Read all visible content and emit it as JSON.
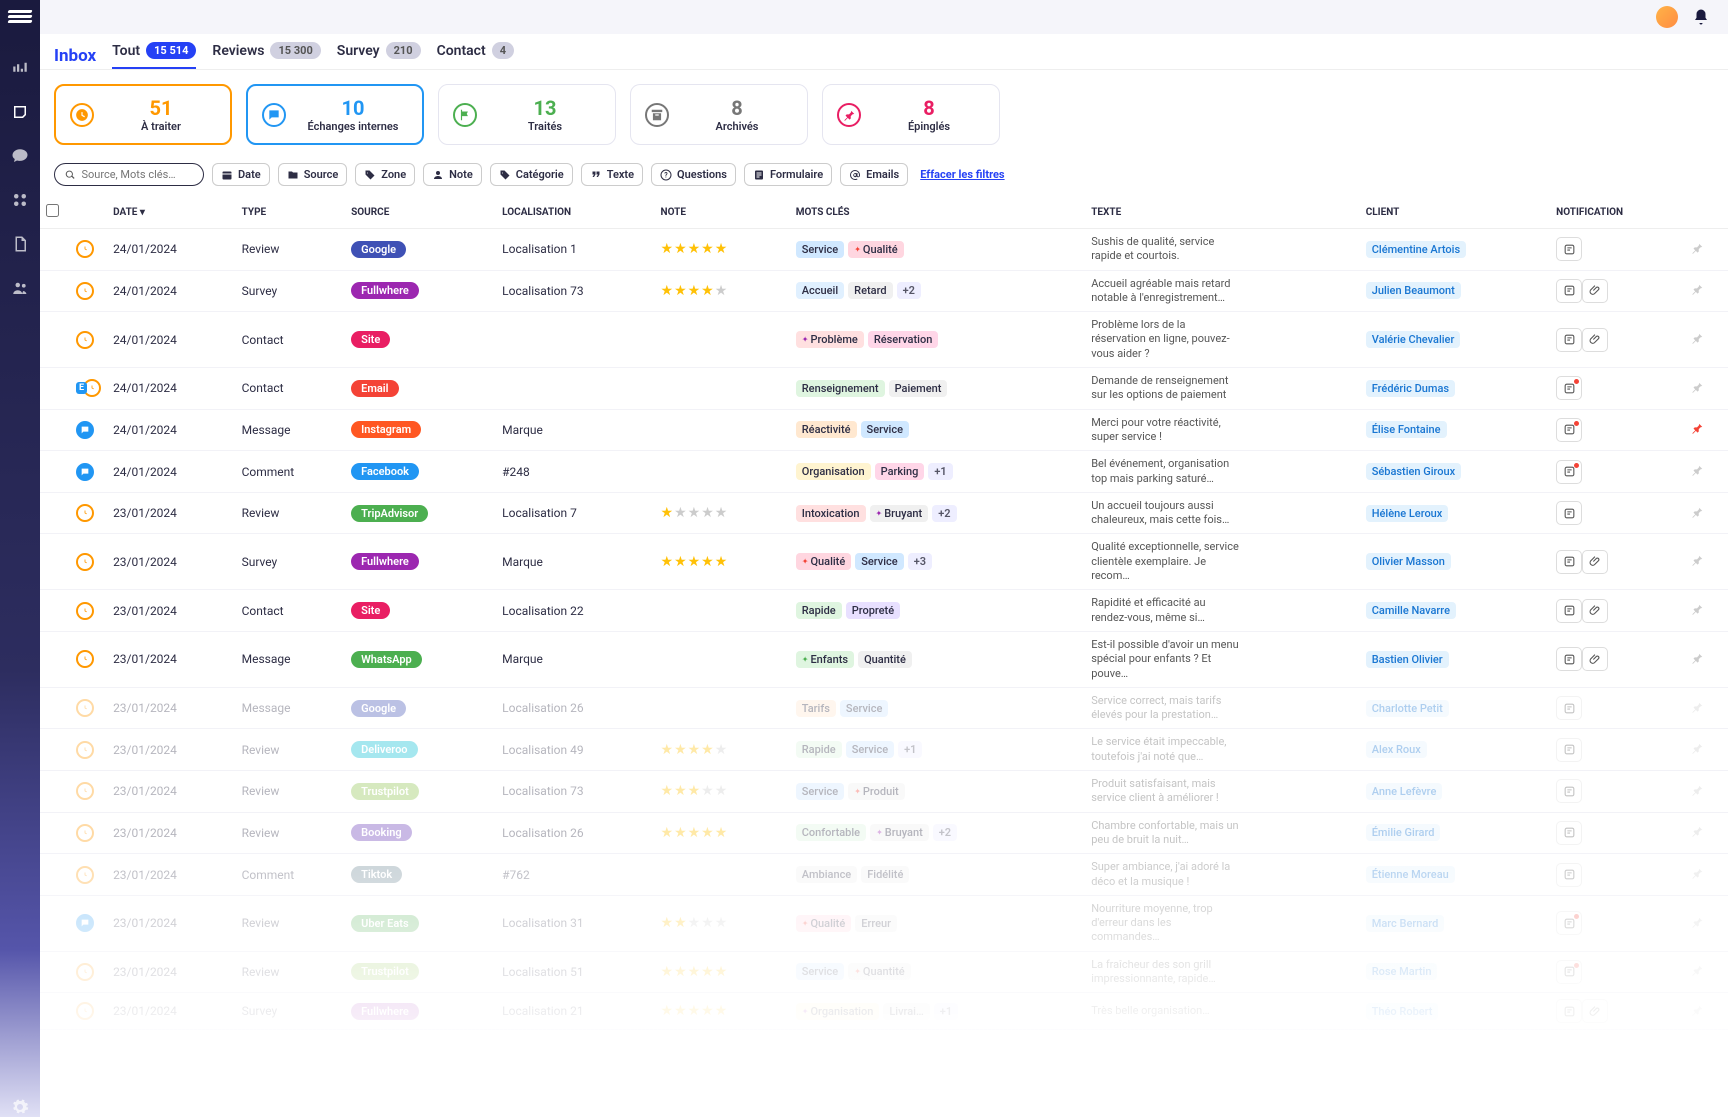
{
  "header": {
    "title": "Inbox"
  },
  "tabs": [
    {
      "label": "Tout",
      "count": "15 514",
      "active": true
    },
    {
      "label": "Reviews",
      "count": "15 300",
      "active": false
    },
    {
      "label": "Survey",
      "count": "210",
      "active": false
    },
    {
      "label": "Contact",
      "count": "4",
      "active": false
    }
  ],
  "cards": [
    {
      "num": "51",
      "label": "À traiter",
      "icon": "clock",
      "color": "#ff9800",
      "highlight": "orange"
    },
    {
      "num": "10",
      "label": "Échanges internes",
      "icon": "chat",
      "color": "#2196f3",
      "highlight": "blue"
    },
    {
      "num": "13",
      "label": "Traités",
      "icon": "flag",
      "color": "#4caf50",
      "highlight": ""
    },
    {
      "num": "8",
      "label": "Archivés",
      "icon": "archive",
      "color": "#777",
      "highlight": ""
    },
    {
      "num": "8",
      "label": "Épinglés",
      "icon": "pin",
      "color": "#e91e63",
      "highlight": ""
    }
  ],
  "search": {
    "placeholder": "Source, Mots clés…"
  },
  "filters": [
    {
      "label": "Date",
      "icon": "calendar"
    },
    {
      "label": "Source",
      "icon": "folder"
    },
    {
      "label": "Zone",
      "icon": "tag"
    },
    {
      "label": "Note",
      "icon": "user"
    },
    {
      "label": "Catégorie",
      "icon": "tag"
    },
    {
      "label": "Texte",
      "icon": "quote"
    },
    {
      "label": "Questions",
      "icon": "help"
    },
    {
      "label": "Formulaire",
      "icon": "form"
    },
    {
      "label": "Emails",
      "icon": "at"
    }
  ],
  "clear_filters": "Effacer les filtres",
  "columns": [
    "",
    "",
    "DATE ▾",
    "TYPE",
    "SOURCE",
    "LOCALISATION",
    "NOTE",
    "MOTS CLÉS",
    "TEXTE",
    "CLIENT",
    "NOTIFICATION",
    ""
  ],
  "tagColors": {
    "Service": "#d0e8ff",
    "Qualité": "#ffd6e0",
    "Accueil": "#e0f0ff",
    "Retard": "#f0f0f0",
    "Problème": "#ffe0e0",
    "Réservation": "#ffd6e8",
    "Renseignement": "#dff5e0",
    "Paiement": "#f0f0f0",
    "Réactivité": "#ffe8d0",
    "Organisation": "#fff4d0",
    "Parking": "#ffd6e8",
    "Intoxication": "#ffe0e0",
    "Bruyant": "#f0f0f0",
    "Rapide": "#dff5e0",
    "Propreté": "#e8e0ff",
    "Enfants": "#dff5e0",
    "Quantité": "#f0f0f0",
    "Tarifs": "#ffe8d0",
    "Produit": "#f0f0f0",
    "Confortable": "#dff5e0",
    "Ambiance": "#f0f0f0",
    "Fidélité": "#f0f0f0",
    "Erreur": "#f0f0f0",
    "Organisation2": "#dff5e0",
    "Livrai…": "#f0f0f0"
  },
  "sourceColors": {
    "Google": "#3f51b5",
    "Fullwhere": "#9c27b0",
    "Site": "#e91e63",
    "Email": "#f44336",
    "Instagram": "#ff5722",
    "Facebook": "#2196f3",
    "TripAdvisor": "#4caf50",
    "WhatsApp": "#4caf50",
    "Deliveroo": "#00bcd4",
    "Trustpilot": "#8bc34a",
    "Booking": "#673ab7",
    "Tiktok": "#607d8b",
    "Uber Eats": "#4caf50"
  },
  "rows": [
    {
      "statusIcon": "clock",
      "statusColor": "orange",
      "date": "24/01/2024",
      "type": "Review",
      "source": "Google",
      "loc": "Localisation 1",
      "stars": 5,
      "tags": [
        {
          "t": "Service"
        },
        {
          "t": "Qualité",
          "dot": "red"
        }
      ],
      "more": "",
      "texte": "Sushis de qualité, service rapide et courtois.",
      "client": "Clémentine Artois",
      "notif": [
        "note"
      ],
      "pinned": false,
      "faded": false
    },
    {
      "statusIcon": "clock",
      "statusColor": "orange",
      "date": "24/01/2024",
      "type": "Survey",
      "source": "Fullwhere",
      "loc": "Localisation 73",
      "stars": 4,
      "tags": [
        {
          "t": "Accueil"
        },
        {
          "t": "Retard"
        }
      ],
      "more": "+2",
      "texte": "Accueil agréable mais retard notable à l'enregistrement…",
      "client": "Julien Beaumont",
      "notif": [
        "note",
        "clip"
      ],
      "pinned": false,
      "faded": false
    },
    {
      "statusIcon": "clock",
      "statusColor": "orange",
      "date": "24/01/2024",
      "type": "Contact",
      "source": "Site",
      "loc": "",
      "stars": 0,
      "tags": [
        {
          "t": "Problème",
          "dot": "purple"
        },
        {
          "t": "Réservation"
        }
      ],
      "more": "",
      "texte": "Problème lors de la réservation en ligne, pouvez-vous aider ?",
      "client": "Valérie Chevalier",
      "notif": [
        "note",
        "clip"
      ],
      "pinned": false,
      "faded": false
    },
    {
      "statusIcon": "clock",
      "statusColor": "orange",
      "badge": "E",
      "date": "24/01/2024",
      "type": "Contact",
      "source": "Email",
      "loc": "",
      "stars": 0,
      "tags": [
        {
          "t": "Renseignement"
        },
        {
          "t": "Paiement"
        }
      ],
      "more": "",
      "texte": "Demande de renseignement sur les options de paiement",
      "client": "Frédéric Dumas",
      "notif": [
        "note-red"
      ],
      "pinned": false,
      "faded": false
    },
    {
      "statusIcon": "chat",
      "statusColor": "blue",
      "date": "24/01/2024",
      "type": "Message",
      "source": "Instagram",
      "loc": "Marque",
      "stars": 0,
      "tags": [
        {
          "t": "Réactivité"
        },
        {
          "t": "Service"
        }
      ],
      "more": "",
      "texte": "Merci pour votre réactivité, super service !",
      "client": "Élise Fontaine",
      "notif": [
        "note-red"
      ],
      "pinned": true,
      "faded": false
    },
    {
      "statusIcon": "chat",
      "statusColor": "blue",
      "date": "24/01/2024",
      "type": "Comment",
      "source": "Facebook",
      "loc": "#248",
      "stars": 0,
      "tags": [
        {
          "t": "Organisation"
        },
        {
          "t": "Parking"
        }
      ],
      "more": "+1",
      "texte": "Bel événement, organisation top mais parking saturé…",
      "client": "Sébastien Giroux",
      "notif": [
        "note-red"
      ],
      "pinned": false,
      "faded": false
    },
    {
      "statusIcon": "clock",
      "statusColor": "orange",
      "date": "23/01/2024",
      "type": "Review",
      "source": "TripAdvisor",
      "loc": "Localisation 7",
      "stars": 1,
      "tags": [
        {
          "t": "Intoxication"
        },
        {
          "t": "Bruyant",
          "dot": "purple"
        }
      ],
      "more": "+2",
      "texte": "Un accueil toujours aussi chaleureux, mais cette fois…",
      "client": "Hélène Leroux",
      "notif": [
        "note"
      ],
      "pinned": false,
      "faded": false
    },
    {
      "statusIcon": "clock",
      "statusColor": "orange",
      "date": "23/01/2024",
      "type": "Survey",
      "source": "Fullwhere",
      "loc": "Marque",
      "stars": 5,
      "tags": [
        {
          "t": "Qualité",
          "dot": "red"
        },
        {
          "t": "Service"
        }
      ],
      "more": "+3",
      "texte": "Qualité exceptionnelle, service clientèle exemplaire. Je recom…",
      "client": "Olivier Masson",
      "notif": [
        "note",
        "clip"
      ],
      "pinned": false,
      "faded": false
    },
    {
      "statusIcon": "clock",
      "statusColor": "orange",
      "date": "23/01/2024",
      "type": "Contact",
      "source": "Site",
      "loc": "Localisation 22",
      "stars": 0,
      "tags": [
        {
          "t": "Rapide"
        },
        {
          "t": "Propreté"
        }
      ],
      "more": "",
      "texte": "Rapidité et efficacité au rendez-vous, même si…",
      "client": "Camille Navarre",
      "notif": [
        "note",
        "clip"
      ],
      "pinned": false,
      "faded": false
    },
    {
      "statusIcon": "clock",
      "statusColor": "orange",
      "date": "23/01/2024",
      "type": "Message",
      "source": "WhatsApp",
      "loc": "Marque",
      "stars": 0,
      "tags": [
        {
          "t": "Enfants",
          "dot": "green"
        },
        {
          "t": "Quantité"
        }
      ],
      "more": "",
      "texte": "Est-il possible d'avoir un menu spécial pour enfants ? Et pouve…",
      "client": "Bastien Olivier",
      "notif": [
        "note",
        "clip"
      ],
      "pinned": false,
      "faded": false
    },
    {
      "statusIcon": "clock",
      "statusColor": "orange",
      "date": "23/01/2024",
      "type": "Message",
      "source": "Google",
      "loc": "Localisation 26",
      "stars": 0,
      "tags": [
        {
          "t": "Tarifs"
        },
        {
          "t": "Service"
        }
      ],
      "more": "",
      "texte": "Service correct, mais tarifs élevés pour la prestation…",
      "client": "Charlotte Petit",
      "notif": [
        "note"
      ],
      "pinned": false,
      "faded": true
    },
    {
      "statusIcon": "clock",
      "statusColor": "orange",
      "date": "23/01/2024",
      "type": "Review",
      "source": "Deliveroo",
      "loc": "Localisation 49",
      "stars": 4,
      "tags": [
        {
          "t": "Rapide"
        },
        {
          "t": "Service"
        }
      ],
      "more": "+1",
      "texte": "Le service était impeccable, toutefois j'ai noté que…",
      "client": "Alex Roux",
      "notif": [
        "note"
      ],
      "pinned": false,
      "faded": true
    },
    {
      "statusIcon": "clock",
      "statusColor": "orange",
      "date": "23/01/2024",
      "type": "Review",
      "source": "Trustpilot",
      "loc": "Localisation 73",
      "stars": 3,
      "tags": [
        {
          "t": "Service"
        },
        {
          "t": "Produit",
          "dot": "red"
        }
      ],
      "more": "",
      "texte": "Produit satisfaisant, mais service client à améliorer !",
      "client": "Anne Lefèvre",
      "notif": [
        "note"
      ],
      "pinned": false,
      "faded": true
    },
    {
      "statusIcon": "clock",
      "statusColor": "orange",
      "date": "23/01/2024",
      "type": "Review",
      "source": "Booking",
      "loc": "Localisation 26",
      "stars": 5,
      "tags": [
        {
          "t": "Confortable"
        },
        {
          "t": "Bruyant",
          "dot": "purple"
        }
      ],
      "more": "+2",
      "texte": "Chambre confortable, mais un peu de bruit la nuit…",
      "client": "Émilie Girard",
      "notif": [
        "note"
      ],
      "pinned": false,
      "faded": true
    },
    {
      "statusIcon": "clock",
      "statusColor": "orange",
      "date": "23/01/2024",
      "type": "Comment",
      "source": "Tiktok",
      "loc": "#762",
      "stars": 0,
      "tags": [
        {
          "t": "Ambiance"
        },
        {
          "t": "Fidélité"
        }
      ],
      "more": "",
      "texte": "Super ambiance, j'ai adoré la déco et la musique !",
      "client": "Étienne Moreau",
      "notif": [
        "note"
      ],
      "pinned": false,
      "faded": true
    },
    {
      "statusIcon": "chat",
      "statusColor": "blue",
      "date": "23/01/2024",
      "type": "Review",
      "source": "Uber Eats",
      "loc": "Localisation 31",
      "stars": 2,
      "tags": [
        {
          "t": "Qualité",
          "dot": "red"
        },
        {
          "t": "Erreur"
        }
      ],
      "more": "",
      "texte": "Nourriture moyenne, trop d'erreur dans les commandes…",
      "client": "Marc Bernard",
      "notif": [
        "note-red"
      ],
      "pinned": false,
      "faded": true
    },
    {
      "statusIcon": "clock",
      "statusColor": "orange",
      "date": "23/01/2024",
      "type": "Review",
      "source": "Trustpilot",
      "loc": "Localisation 51",
      "stars": 5,
      "tags": [
        {
          "t": "Service"
        },
        {
          "t": "Quantité",
          "dot": "red"
        }
      ],
      "more": "",
      "texte": "La fraîcheur des son grill impressionnante, rapide…",
      "client": "Rose Martin",
      "notif": [
        "note-red"
      ],
      "pinned": false,
      "faded": true
    },
    {
      "statusIcon": "clock",
      "statusColor": "orange",
      "date": "23/01/2024",
      "type": "Survey",
      "source": "Fullwhere",
      "loc": "Localisation 21",
      "stars": 5,
      "tags": [
        {
          "t": "Organisation",
          "dot": "purple"
        },
        {
          "t": "Livrai…"
        }
      ],
      "more": "+1",
      "texte": "Très belle organisation…",
      "client": "Théo Robert",
      "notif": [
        "note",
        "clip"
      ],
      "pinned": false,
      "faded": true
    }
  ]
}
